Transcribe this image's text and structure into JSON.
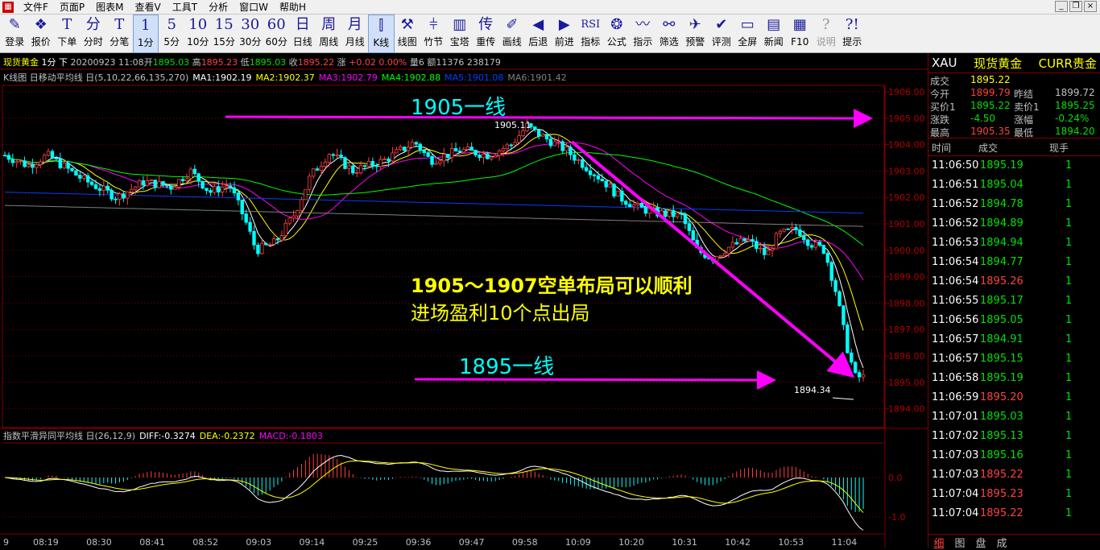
{
  "menubar": {
    "items": [
      "文件F",
      "页面P",
      "图表M",
      "查看V",
      "工具T",
      "分析",
      "窗口W",
      "帮助H"
    ]
  },
  "toolbar": {
    "buttons": [
      {
        "icon": "✎",
        "label": "登录",
        "name": "login-button"
      },
      {
        "icon": "❖",
        "label": "报价",
        "name": "quote-button"
      },
      {
        "icon": "T",
        "label": "下单",
        "name": "order-button"
      },
      {
        "icon": "分",
        "label": "分时",
        "name": "timeshare-button"
      },
      {
        "icon": "T",
        "label": "分笔",
        "name": "tick-button"
      },
      {
        "icon": "1",
        "label": "1分",
        "name": "period-1m-button",
        "active": true
      },
      {
        "icon": "5",
        "label": "5分",
        "name": "period-5m-button"
      },
      {
        "icon": "10",
        "label": "10分",
        "name": "period-10m-button"
      },
      {
        "icon": "15",
        "label": "15分",
        "name": "period-15m-button"
      },
      {
        "icon": "30",
        "label": "30分",
        "name": "period-30m-button"
      },
      {
        "icon": "60",
        "label": "60分",
        "name": "period-60m-button"
      },
      {
        "icon": "日",
        "label": "日线",
        "name": "daily-button"
      },
      {
        "icon": "周",
        "label": "周线",
        "name": "weekly-button"
      },
      {
        "icon": "月",
        "label": "月线",
        "name": "monthly-button"
      },
      {
        "icon": "⫿",
        "label": "K线",
        "name": "kline-button",
        "active": true
      },
      {
        "icon": "⚒",
        "label": "线图",
        "name": "linechart-button"
      },
      {
        "icon": "⫩",
        "label": "竹节",
        "name": "bamboo-button"
      },
      {
        "icon": "▥",
        "label": "宝塔",
        "name": "tower-button"
      },
      {
        "icon": "传",
        "label": "重传",
        "name": "resend-button"
      },
      {
        "icon": "✐",
        "label": "画线",
        "name": "draw-button"
      },
      {
        "icon": "◀",
        "label": "后退",
        "name": "back-button"
      },
      {
        "icon": "▶",
        "label": "前进",
        "name": "forward-button"
      },
      {
        "icon": "RSI",
        "label": "指标",
        "name": "indicator-button"
      },
      {
        "icon": "❂",
        "label": "公式",
        "name": "formula-button"
      },
      {
        "icon": "〰",
        "label": "指示",
        "name": "signal-button"
      },
      {
        "icon": "⚯",
        "label": "筛选",
        "name": "filter-button"
      },
      {
        "icon": "✈",
        "label": "预警",
        "name": "alert-button"
      },
      {
        "icon": "✔",
        "label": "评测",
        "name": "evaluate-button"
      },
      {
        "icon": "▭",
        "label": "全屏",
        "name": "fullscreen-button"
      },
      {
        "icon": "▤",
        "label": "新闻",
        "name": "news-button"
      },
      {
        "icon": "▦",
        "label": "F10",
        "name": "f10-button"
      },
      {
        "icon": "?",
        "label": "说明",
        "name": "explain-button",
        "dim": true
      },
      {
        "icon": "?!",
        "label": "提示",
        "name": "hint-button"
      }
    ]
  },
  "header": {
    "name": "现货黄金",
    "period": "1分",
    "down": "下",
    "date_time": "20200923 11:08",
    "open_label": "开",
    "open": "1895.03",
    "high_label": "高",
    "high": "1895.23",
    "low_label": "低",
    "low": "1895.03",
    "close_label": "收",
    "close": "1895.22",
    "change_label": "涨",
    "change": "+0.02",
    "change_pct": "0.00%",
    "volume_label": "量",
    "volume": "6",
    "amount_label": "额",
    "amount": "11376 238179"
  },
  "ma_bar": {
    "title": "K线图 日移动平均线 日(5,10,22,66,135,270)",
    "items": [
      {
        "text": "MA1:1902.19",
        "color": "#ffffff"
      },
      {
        "text": "MA2:1902.37",
        "color": "#ffff00"
      },
      {
        "text": "MA3:1902.79",
        "color": "#ff00ff"
      },
      {
        "text": "MA4:1902.88",
        "color": "#00ff00"
      },
      {
        "text": "MA5:1901.08",
        "color": "#0040ff"
      },
      {
        "text": "MA6:1901.42",
        "color": "#808080"
      }
    ]
  },
  "price_axis": [
    "1906.00",
    "1905.00",
    "1904.00",
    "1903.00",
    "1902.00",
    "1901.00",
    "1900.00",
    "1899.00",
    "1898.00",
    "1897.00",
    "1896.00",
    "1895.00",
    "1894.00"
  ],
  "annotations": {
    "line_1905": "1905一线",
    "line_1895": "1895一线",
    "strategy_1": "1905～1907空单布局可以顺利",
    "strategy_2": "进场盈利10个点出局",
    "high_mark": "1905.11",
    "low_mark": "1894.34"
  },
  "macd": {
    "title": "指数平滑异同平均线 日(26,12,9)",
    "diff": "DIFF:-0.3274",
    "dea": "DEA:-0.2372",
    "macd": "MACD:-0.1803",
    "axis": [
      "0.0",
      "-1.0"
    ]
  },
  "time_axis": [
    "9",
    "08:19",
    "08:30",
    "08:41",
    "08:52",
    "09:03",
    "09:14",
    "09:25",
    "09:36",
    "09:47",
    "09:58",
    "10:09",
    "10:20",
    "10:31",
    "10:42",
    "10:53",
    "11:04"
  ],
  "side": {
    "symbol": "XAU",
    "name": "现货黄金",
    "market": "CURR贵金",
    "quote": {
      "last_label": "成交",
      "last": "1895.22",
      "open_label": "今开",
      "open": "1899.79",
      "prev_label": "昨结",
      "prev": "1899.72",
      "bid_label": "买价1",
      "bid": "1895.22",
      "ask_label": "卖价1",
      "ask": "1895.25",
      "chg_label": "涨跌",
      "chg": "-4.50",
      "pct_label": "涨幅",
      "pct": "-0.24%",
      "high_label": "最高",
      "high": "1905.35",
      "low_label": "最低",
      "low": "1894.20"
    },
    "tick_headers": {
      "time": "时间",
      "price": "成交",
      "qty": "现手"
    },
    "ticks": [
      {
        "time": "11:06:50",
        "price": "1895.19",
        "qty": "1"
      },
      {
        "time": "11:06:51",
        "price": "1895.04",
        "qty": "1"
      },
      {
        "time": "11:06:52",
        "price": "1894.78",
        "qty": "1"
      },
      {
        "time": "11:06:52",
        "price": "1894.89",
        "qty": "1"
      },
      {
        "time": "11:06:53",
        "price": "1894.94",
        "qty": "1"
      },
      {
        "time": "11:06:54",
        "price": "1894.77",
        "qty": "1"
      },
      {
        "time": "11:06:54",
        "price": "1895.26",
        "qty": "1"
      },
      {
        "time": "11:06:55",
        "price": "1895.17",
        "qty": "1"
      },
      {
        "time": "11:06:56",
        "price": "1895.05",
        "qty": "1"
      },
      {
        "time": "11:06:57",
        "price": "1894.91",
        "qty": "1"
      },
      {
        "time": "11:06:57",
        "price": "1895.15",
        "qty": "1"
      },
      {
        "time": "11:06:58",
        "price": "1895.19",
        "qty": "1"
      },
      {
        "time": "11:06:59",
        "price": "1895.20",
        "qty": "1"
      },
      {
        "time": "11:07:01",
        "price": "1895.03",
        "qty": "1"
      },
      {
        "time": "11:07:02",
        "price": "1895.13",
        "qty": "1"
      },
      {
        "time": "11:07:03",
        "price": "1895.16",
        "qty": "1"
      },
      {
        "time": "11:07:03",
        "price": "1895.22",
        "qty": "1"
      },
      {
        "time": "11:07:04",
        "price": "1895.23",
        "qty": "1"
      },
      {
        "time": "11:07:04",
        "price": "1895.22",
        "qty": "1"
      }
    ],
    "tabs": [
      "细",
      "图",
      "盘",
      "成"
    ]
  },
  "colors": {
    "up": "#ff4040",
    "down": "#00ffff",
    "grid": "#7f0000",
    "annotation": "#ff00ff"
  }
}
